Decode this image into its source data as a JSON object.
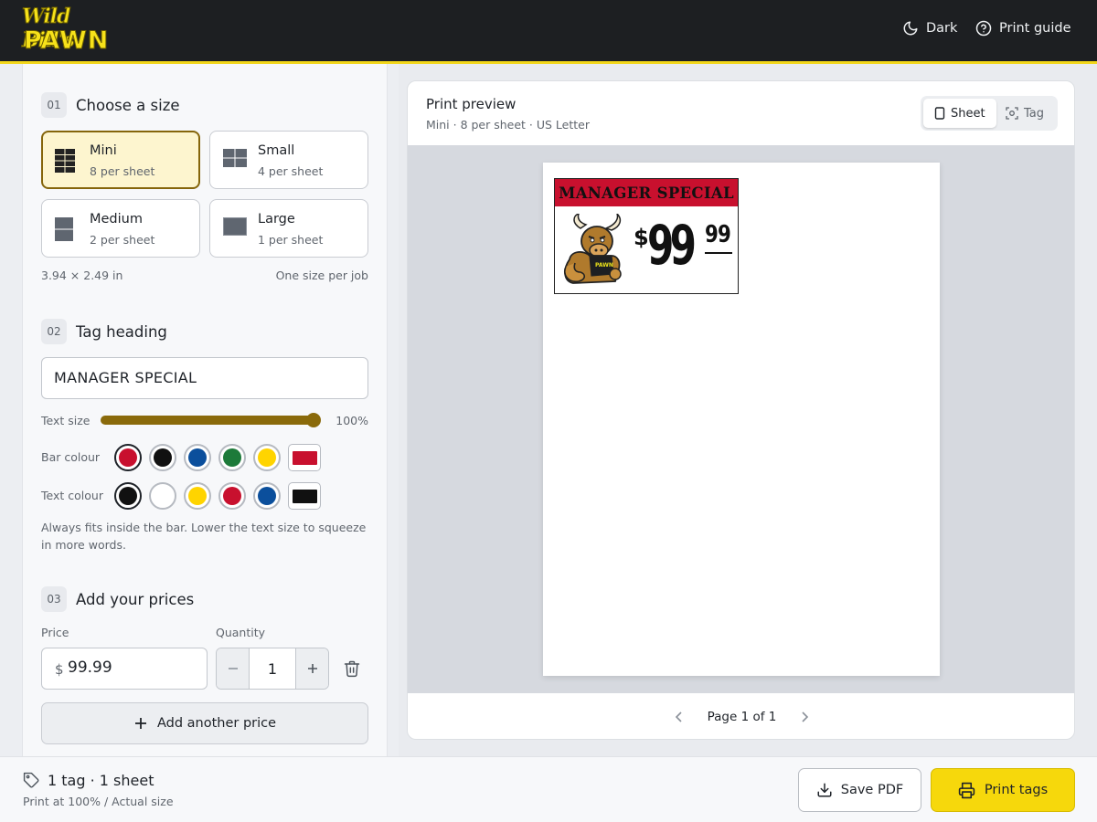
{
  "header": {
    "logo_line1": "Wild Bill's",
    "logo_line2": "PAWN",
    "dark_label": "Dark",
    "guide_label": "Print guide"
  },
  "step1": {
    "num": "01",
    "title": "Choose a size",
    "sizes": [
      {
        "name": "Mini",
        "sub": "8 per sheet",
        "selected": true
      },
      {
        "name": "Small",
        "sub": "4 per sheet",
        "selected": false
      },
      {
        "name": "Medium",
        "sub": "2 per sheet",
        "selected": false
      },
      {
        "name": "Large",
        "sub": "1 per sheet",
        "selected": false
      }
    ],
    "dimensions": "3.94 × 2.49 in",
    "note": "One size per job"
  },
  "step2": {
    "num": "02",
    "title": "Tag heading",
    "heading_value": "MANAGER SPECIAL",
    "text_size_label": "Text size",
    "text_size_value": "100%",
    "text_size_fraction": 1.0,
    "bar_colour_label": "Bar colour",
    "bar_colours": [
      "#c8102e",
      "#111111",
      "#0b4f9c",
      "#1d7a3a",
      "#ffd400"
    ],
    "bar_custom": "#c8102e",
    "text_colour_label": "Text colour",
    "text_colours": [
      "#111111",
      "#ffffff",
      "#ffd400",
      "#c8102e",
      "#0b4f9c"
    ],
    "text_custom": "#111111",
    "hint": "Always fits inside the bar. Lower the text size to squeeze in more words."
  },
  "step3": {
    "num": "03",
    "title": "Add your prices",
    "price_label": "Price",
    "quantity_label": "Quantity",
    "currency": "$",
    "price_value": "99.99",
    "quantity_value": "1",
    "add_label": "Add another price"
  },
  "preview": {
    "title": "Print preview",
    "subtitle": "Mini · 8 per sheet · US Letter",
    "tab_sheet": "Sheet",
    "tab_tag": "Tag",
    "tag_heading": "MANAGER SPECIAL",
    "tag_dollar_sign": "$",
    "tag_dollars": "99",
    "tag_cents": "99",
    "page_text": "Page 1 of 1"
  },
  "footer": {
    "summary": "1 tag · 1 sheet",
    "sub": "Print at 100% / Actual size",
    "save_label": "Save PDF",
    "print_label": "Print tags"
  },
  "colors": {
    "accent": "#f6d80c",
    "selected_border": "#85650b",
    "slider": "#8a6a0b"
  }
}
